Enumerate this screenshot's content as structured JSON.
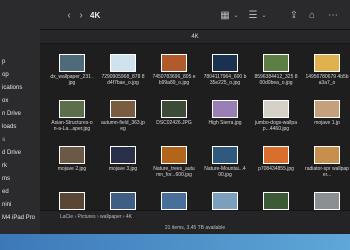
{
  "window": {
    "title": "4K",
    "tab_label": "4K"
  },
  "sidebar": {
    "items": [
      {
        "label": "p",
        "head": false
      },
      {
        "label": "op",
        "head": false
      },
      {
        "label": "ications",
        "head": false
      },
      {
        "label": "ox",
        "head": false
      },
      {
        "label": "n Drive",
        "head": false
      },
      {
        "label": "loads",
        "head": false
      },
      {
        "label": "s",
        "head": true
      },
      {
        "label": "d Drive",
        "head": false
      },
      {
        "label": "rk",
        "head": false
      },
      {
        "label": "ms",
        "head": false
      },
      {
        "label": "ed",
        "head": false
      },
      {
        "label": "nini",
        "head": false
      },
      {
        "label": "M4 iPad Pro",
        "head": false
      }
    ]
  },
  "files": [
    {
      "name": "dx_wallpaper_231 .jpg",
      "row": 0,
      "col": 0,
      "color": "#4f6b7a"
    },
    {
      "name": "7290905968_878 8d4f7bae_o.jpg",
      "row": 0,
      "col": 1,
      "color": "#cfe3ee"
    },
    {
      "name": "7450783696_805 eb99a89_o.jpg",
      "row": 0,
      "col": 2,
      "color": "#b15a2a"
    },
    {
      "name": "7804117964_600 b35e225_o.jpg",
      "row": 0,
      "col": 3,
      "color": "#1b3150"
    },
    {
      "name": "8596384412_325 800d0bea_o.jpg",
      "row": 0,
      "col": 4,
      "color": "#5d7f43"
    },
    {
      "name": "14956780679 4b5ba3a7_o",
      "row": 0,
      "col": 5,
      "color": "#e0b14d"
    },
    {
      "name": "Asian-Structures-on-a-La...aper.jpg",
      "row": 1,
      "col": 0,
      "color": "#5b6f4a"
    },
    {
      "name": "autumn-field_363.jpeg",
      "row": 1,
      "col": 1,
      "color": "#7a5d40"
    },
    {
      "name": "DSC02426.JPG",
      "row": 1,
      "col": 2,
      "color": "#3b4b38"
    },
    {
      "name": "High Sierra.jpg",
      "row": 1,
      "col": 3,
      "color": "#9a7fb6"
    },
    {
      "name": "jumbo-dogs-wallpap...4460.jpg",
      "row": 1,
      "col": 4,
      "color": "#d5d0c8"
    },
    {
      "name": "mojave 1.jp",
      "row": 1,
      "col": 5,
      "color": "#c6a07a"
    },
    {
      "name": "mojave 2.jpg",
      "row": 2,
      "col": 0,
      "color": "#6b5847"
    },
    {
      "name": "mojave 3.jpg",
      "row": 2,
      "col": 1,
      "color": "#2a2f4a"
    },
    {
      "name": "Nature_trees_autumn_for...600.jpg",
      "row": 2,
      "col": 2,
      "color": "#b3651c"
    },
    {
      "name": "Nature-Mountai...400.jpg",
      "row": 2,
      "col": 3,
      "color": "#2f5a7e"
    },
    {
      "name": "p708434855.jpg",
      "row": 2,
      "col": 4,
      "color": "#d96f2c"
    },
    {
      "name": "radiator-spr wallpaper...",
      "row": 2,
      "col": 5,
      "color": "#c88f4c"
    },
    {
      "name": "",
      "row": 3,
      "col": 0,
      "color": "#5a4635"
    },
    {
      "name": "",
      "row": 3,
      "col": 1,
      "color": "#3e5f83"
    },
    {
      "name": "",
      "row": 3,
      "col": 2,
      "color": "#486f9a"
    },
    {
      "name": "",
      "row": 3,
      "col": 3,
      "color": "#7aa0be"
    },
    {
      "name": "",
      "row": 3,
      "col": 4,
      "color": "#3c5a36"
    },
    {
      "name": "",
      "row": 3,
      "col": 5,
      "color": "#8b8f92"
    }
  ],
  "pathbar": {
    "segments": [
      "LaCie",
      "Pictures",
      "wallpaper",
      "4K"
    ]
  },
  "status": {
    "text": "21 items, 3.45 TB available"
  }
}
